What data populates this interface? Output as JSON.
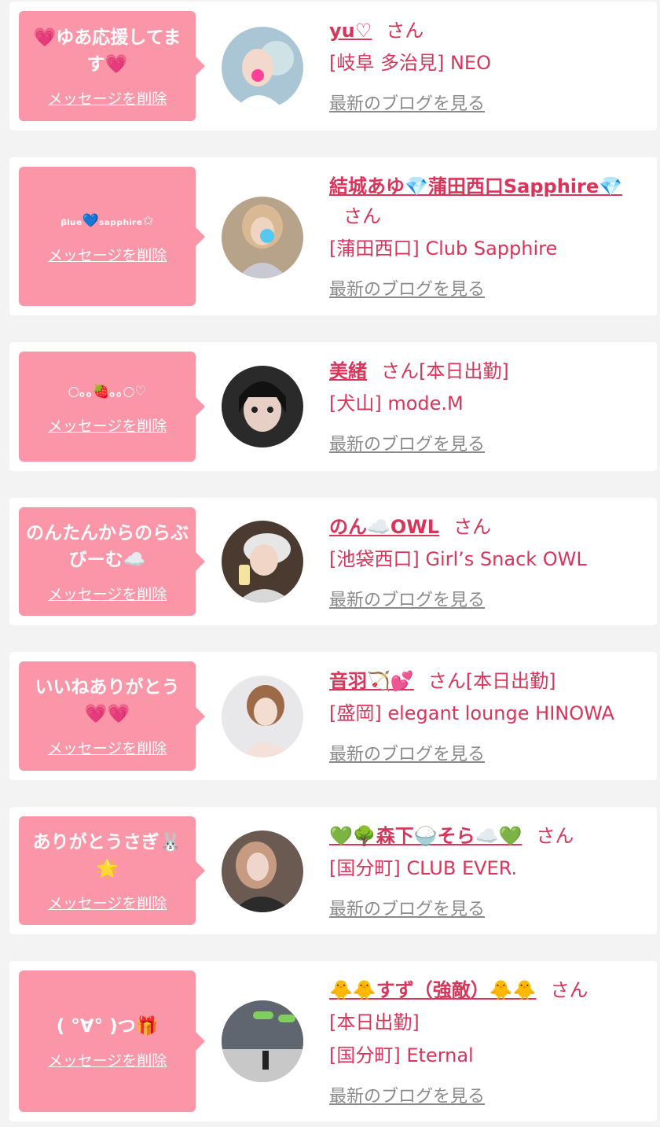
{
  "favorites": [
    {
      "message": "💗ゆあ応援してます💗",
      "delete_label": "メッセージを削除",
      "name": "yu♡",
      "honorific": "さん",
      "working": "",
      "shop": "[岐阜 多治見] NEO",
      "blog_link": "最新のブログを見る"
    },
    {
      "message": "ᵦₗᵤₑ💙ₛₐₚₚₕᵢᵣₑ✩",
      "delete_label": "メッセージを削除",
      "name": "結城あゆ💎蒲田西口Sapphire💎",
      "honorific": "さん",
      "working": "",
      "shop": "[蒲田西口] Club Sapphire",
      "blog_link": "最新のブログを見る"
    },
    {
      "message": "○｡｡🍓｡｡○♡",
      "delete_label": "メッセージを削除",
      "name": "美緒",
      "honorific": "さん",
      "working": "[本日出勤]",
      "shop": "[犬山] mode.M",
      "blog_link": "最新のブログを見る"
    },
    {
      "message": "のんたんからのらぶびーむ☁️",
      "delete_label": "メッセージを削除",
      "name": "のん☁️OWL",
      "honorific": "さん",
      "working": "",
      "shop": "[池袋西口] Girl’s Snack OWL",
      "blog_link": "最新のブログを見る"
    },
    {
      "message": "いいねありがとう💗💗",
      "delete_label": "メッセージを削除",
      "name": "音羽🏹💕",
      "honorific": "さん",
      "working": "[本日出勤]",
      "shop": "[盛岡] elegant lounge HINOWA",
      "blog_link": "最新のブログを見る"
    },
    {
      "message": "ありがとうさぎ🐰🌟",
      "delete_label": "メッセージを削除",
      "name": "💚🌳森下🍚そら☁️💚",
      "honorific": "さん",
      "working": "",
      "shop": "[国分町] CLUB EVER.",
      "blog_link": "最新のブログを見る"
    },
    {
      "message": "( °∀° )つ🎁",
      "delete_label": "メッセージを削除",
      "name": "🐥🐥すず（強敵）🐥🐥",
      "honorific": "さん",
      "working": "[本日出勤]",
      "shop": "[国分町] Eternal",
      "blog_link": "最新のブログを見る"
    }
  ],
  "colors": {
    "accent": "#d9345a",
    "bubble": "#fb96a8",
    "card": "#ffffff",
    "page": "#f3f3f3",
    "link_gray": "#8a8a8a"
  }
}
